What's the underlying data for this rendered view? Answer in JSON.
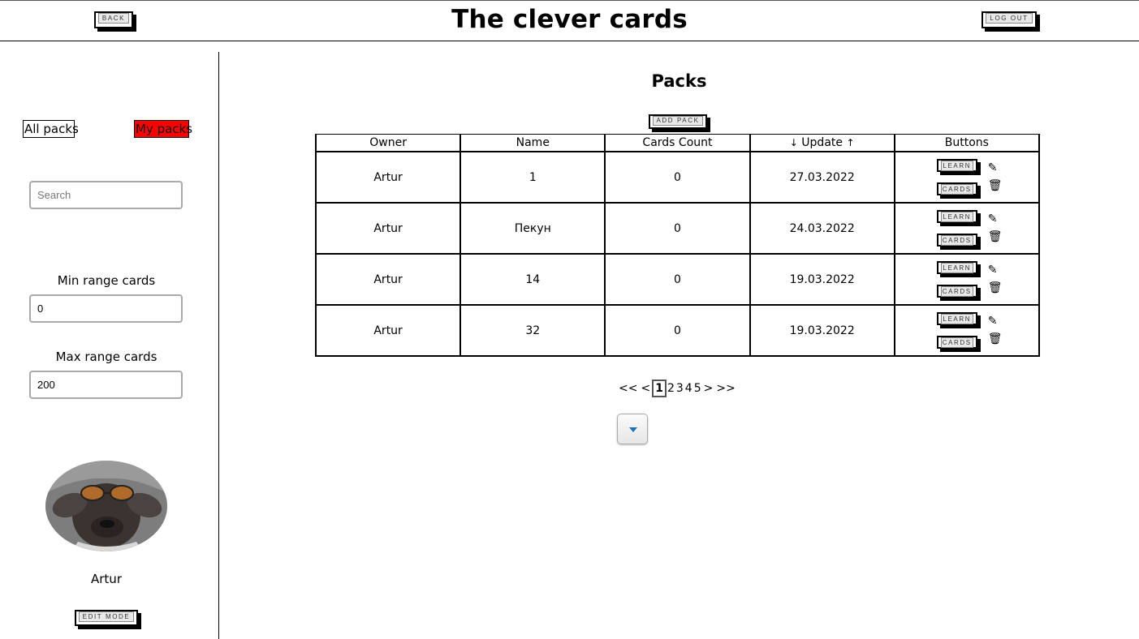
{
  "header": {
    "title": "The clever cards",
    "back_label": "BACK",
    "logout_label": "LOG OUT"
  },
  "sidebar": {
    "tabs": [
      {
        "label": "All packs",
        "active": false
      },
      {
        "label": "My packs",
        "active": true,
        "color": "#ff0000"
      }
    ],
    "search_placeholder": "Search",
    "min_label": "Min range cards",
    "min_value": "0",
    "max_label": "Max range cards",
    "max_value": "200",
    "username": "Artur",
    "edit_mode_label": "EDIT MODE"
  },
  "main": {
    "title": "Packs",
    "add_pack_label": "ADD PACK",
    "columns": [
      "Owner",
      "Name",
      "Cards Count",
      "Update",
      "Buttons"
    ],
    "sort_desc_icon": "↓",
    "sort_asc_icon": "↑",
    "learn_label": "LEARN",
    "cards_label": "CARDS",
    "rows": [
      {
        "owner": "Artur",
        "name": "1",
        "cards_count": "0",
        "updated": "27.03.2022"
      },
      {
        "owner": "Artur",
        "name": "Пекун",
        "cards_count": "0",
        "updated": "24.03.2022"
      },
      {
        "owner": "Artur",
        "name": "14",
        "cards_count": "0",
        "updated": "19.03.2022"
      },
      {
        "owner": "Artur",
        "name": "32",
        "cards_count": "0",
        "updated": "19.03.2022"
      }
    ],
    "pagination": {
      "first": "<<",
      "prev": "<",
      "pages": [
        "1",
        "2",
        "3",
        "4",
        "5"
      ],
      "current": "1",
      "next": ">",
      "last": ">>"
    }
  }
}
